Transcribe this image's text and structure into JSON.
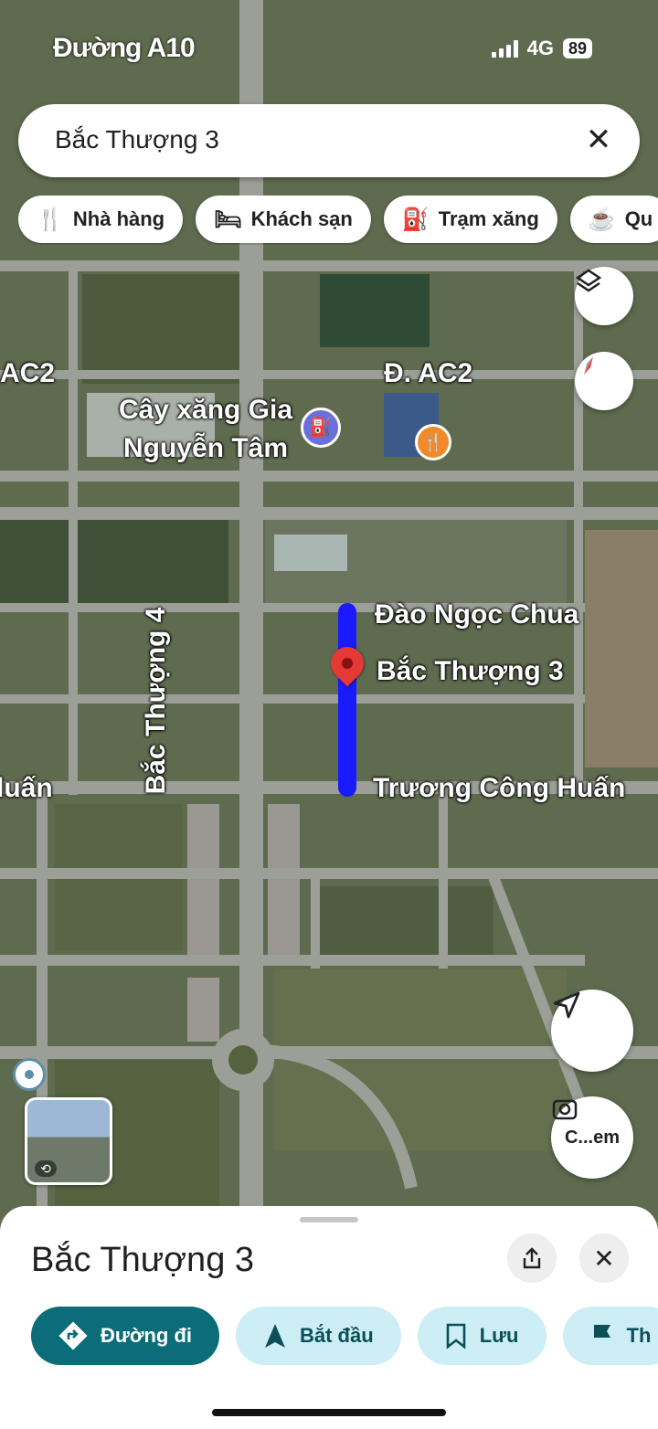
{
  "status_bar": {
    "time": "Đường A10",
    "network": "4G",
    "battery": "89"
  },
  "search": {
    "query": "Bắc Thượng 3",
    "clear_icon": "close-icon"
  },
  "chips": [
    {
      "icon": "restaurant-icon",
      "label": "Nhà hàng"
    },
    {
      "icon": "hotel-icon",
      "label": "Khách sạn"
    },
    {
      "icon": "gas-station-icon",
      "label": "Trạm xăng"
    },
    {
      "icon": "coffee-icon",
      "label": "Qu"
    }
  ],
  "map": {
    "labels": {
      "ac2_left": "AC2",
      "ac2_right": "Đ. AC2",
      "gas_station": "Cây xăng Gia Nguyễn Tâm",
      "dao_ngoc_chua": "Đào Ngọc Chua",
      "bac_thuong_3": "Bắc Thượng 3",
      "bac_thuong_4": "Bắc Thượng 4",
      "truong_cong_huan": "Trương Công Huấn",
      "huan_left": "luấn"
    },
    "route_color": "#1a1aff",
    "pin_color": "#e53935"
  },
  "controls": {
    "layers_icon": "layers-icon",
    "compass_icon": "compass-icon",
    "locate_icon": "navigation-arrow-icon",
    "lens_icon": "camera-search-icon",
    "lens_label": "C...em"
  },
  "sheet": {
    "title": "Bắc Thượng 3",
    "actions": [
      {
        "icon": "directions-icon",
        "label": "Đường đi"
      },
      {
        "icon": "navigation-icon",
        "label": "Bắt đầu"
      },
      {
        "icon": "bookmark-icon",
        "label": "Lưu"
      },
      {
        "icon": "flag-icon",
        "label": "Th"
      }
    ]
  }
}
